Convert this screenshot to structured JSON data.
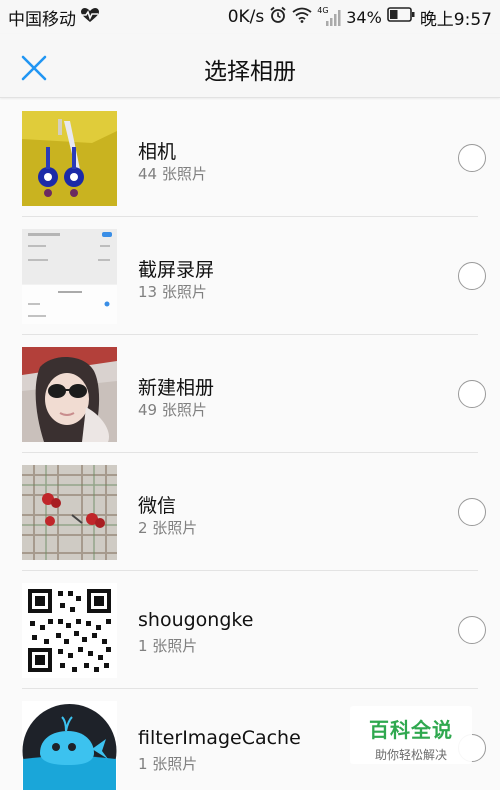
{
  "status_bar": {
    "carrier": "中国移动",
    "net_speed": "0K/s",
    "network_type": "4G",
    "battery": "34%",
    "time": "晚上9:57"
  },
  "header": {
    "title": "选择相册"
  },
  "albums": [
    {
      "name": "相机",
      "count": "44 张照片"
    },
    {
      "name": "截屏录屏",
      "count": "13 张照片"
    },
    {
      "name": "新建相册",
      "count": "49 张照片"
    },
    {
      "name": "微信",
      "count": "2 张照片"
    },
    {
      "name": "shougongke",
      "count": "1 张照片"
    },
    {
      "name": "filterImageCache",
      "count": "1 张照片"
    }
  ],
  "watermark": {
    "title": "百科全说",
    "subtitle": "助你轻松解决"
  },
  "colors": {
    "accent": "#2196f3",
    "watermark_green": "#2fa84f"
  }
}
